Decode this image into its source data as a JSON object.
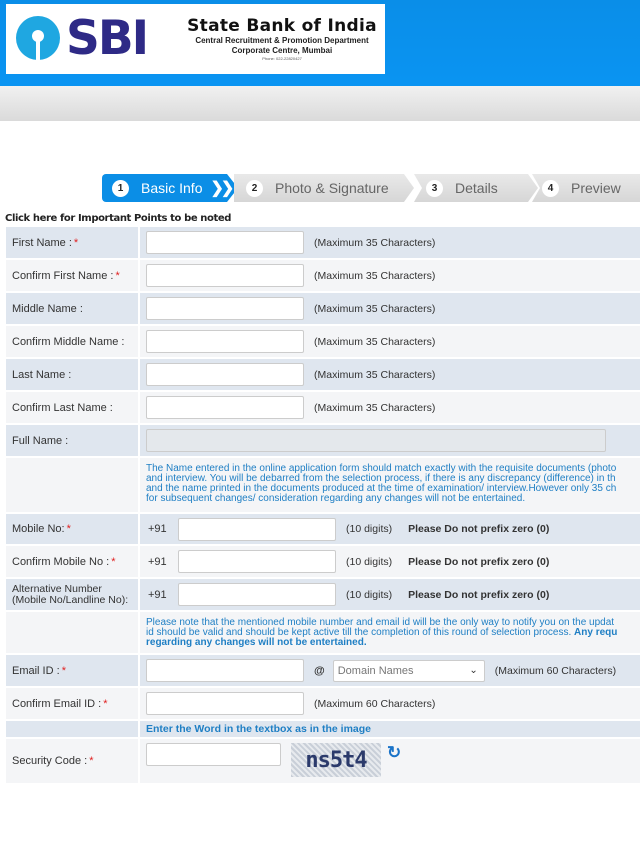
{
  "header": {
    "logo_text": "SBI",
    "org_title": "State Bank of India",
    "org_line1": "Central Recruitment & Promotion Department",
    "org_line2": "Corporate Centre, Mumbai",
    "org_phone": "Phone: 022-22820427",
    "brand_color": "#0a8ee8"
  },
  "steps": [
    {
      "num": "1",
      "label": "Basic Info",
      "active": true
    },
    {
      "num": "2",
      "label": "Photo & Signature",
      "active": false
    },
    {
      "num": "3",
      "label": "Details",
      "active": false
    },
    {
      "num": "4",
      "label": "Preview",
      "active": false
    }
  ],
  "important_link": "Click here for Important Points to be noted",
  "form": {
    "required_mark": "*",
    "max35": "(Maximum 35 Characters)",
    "max60": "(Maximum 60 Characters)",
    "first_name": {
      "label": "First Name :",
      "value": ""
    },
    "confirm_first_name": {
      "label": "Confirm First Name :",
      "value": ""
    },
    "middle_name": {
      "label": "Middle Name :",
      "value": ""
    },
    "confirm_middle_name": {
      "label": "Confirm Middle Name :",
      "value": ""
    },
    "last_name": {
      "label": "Last Name :",
      "value": ""
    },
    "confirm_last_name": {
      "label": "Confirm Last Name :",
      "value": ""
    },
    "full_name": {
      "label": "Full Name :",
      "value": ""
    },
    "name_note": [
      "The Name entered in the online application form should match exactly with the requisite documents (photo",
      "and interview. You will be debarred from the selection process, if there is any discrepancy (difference) in th",
      "and the name printed in the documents produced at the time of examination/ interview.However only 35 ch",
      "for subsequent changes/ consideration regarding any changes will not be entertained."
    ],
    "country_code": "+91",
    "digits_hint": "(10 digits)",
    "no_zero_hint": "Please Do not prefix zero (0)",
    "mobile": {
      "label": "Mobile No:",
      "value": ""
    },
    "confirm_mobile": {
      "label": "Confirm Mobile No :",
      "value": ""
    },
    "alt_number": {
      "label_line1": "Alternative Number",
      "label_line2": "(Mobile No/Landline No):",
      "value": ""
    },
    "contact_note": {
      "line1": "Please note that the mentioned mobile number and email id will be the only way to notify you on the updat",
      "line2_plain": "id should be valid and should be kept active till the completion of this round of selection process. ",
      "line2_bold": "Any requ",
      "line3_bold": "regarding any changes will not be entertained."
    },
    "email": {
      "label": "Email ID :",
      "value": "",
      "at": "@",
      "domain_placeholder": "Domain Names"
    },
    "confirm_email": {
      "label": "Confirm Email ID :",
      "value": ""
    },
    "captcha_prompt": "Enter the Word in the textbox as in the image",
    "security_code": {
      "label": "Security Code :",
      "value": "",
      "captcha_text": "ns5t4"
    }
  },
  "colors": {
    "row_a": "#dfe6ef",
    "row_b": "#f4f5f7",
    "note_blue": "#1f7fc4",
    "required_red": "#e02020"
  }
}
